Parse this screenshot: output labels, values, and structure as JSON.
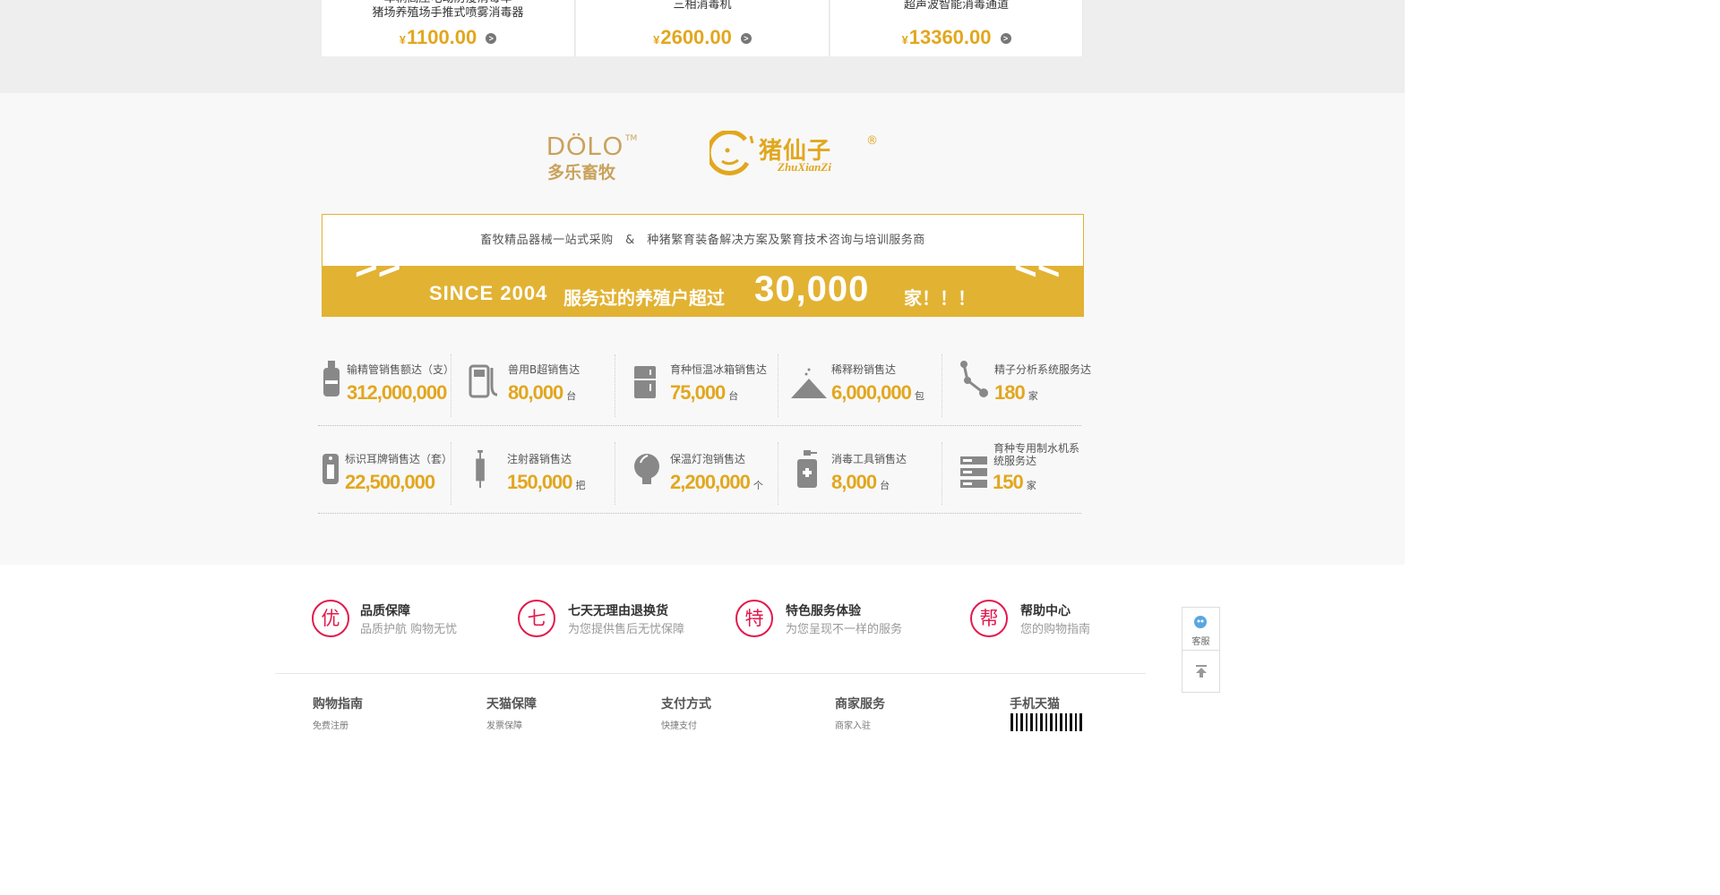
{
  "products": [
    {
      "name": "车辆高压电动防疫消毒车\n猪场养殖场手推式喷雾消毒器",
      "currency": "¥",
      "price": "1100.00",
      "arrow": ">"
    },
    {
      "name": "三相消毒机",
      "currency": "¥",
      "price": "2600.00",
      "arrow": ">"
    },
    {
      "name": "超声波智能消毒通道",
      "currency": "¥",
      "price": "13360.00",
      "arrow": ">"
    }
  ],
  "brands": {
    "dolo_name": "DÖLO",
    "dolo_tm": "TM",
    "dolo_cn": "多乐畜牧",
    "zhuxianzi_cn": "猪仙子",
    "zhuxianzi_reg": "®",
    "zhuxianzi_pinyin": "ZhuXianZi"
  },
  "promo": {
    "tagline": "畜牧精品器械一站式采购　&　种猪繁育装备解决方案及繁育技术咨询与培训服务商",
    "since": "SINCE 2004",
    "served": "服务过的养殖户超过",
    "count": "30,000",
    "suffix": "家！！！",
    "chev_left": ">>",
    "chev_right": "<<"
  },
  "stats": [
    {
      "label": "输精管销售额达（支）",
      "value": "312,000,000",
      "unit": "",
      "icon": "semen-bottle-icon"
    },
    {
      "label": "兽用B超销售达",
      "value": "80,000",
      "unit": "台",
      "icon": "ultrasound-icon"
    },
    {
      "label": "育种恒温冰箱销售达",
      "value": "75,000",
      "unit": "台",
      "icon": "fridge-icon"
    },
    {
      "label": "稀释粉销售达",
      "value": "6,000,000",
      "unit": "包",
      "icon": "powder-pile-icon"
    },
    {
      "label": "精子分析系统服务达",
      "value": "180",
      "unit": "家",
      "icon": "network-icon"
    },
    {
      "label": "标识耳牌销售达（套）",
      "value": "22,500,000",
      "unit": "",
      "icon": "ear-tag-icon"
    },
    {
      "label": "注射器销售达",
      "value": "150,000",
      "unit": "把",
      "icon": "syringe-icon"
    },
    {
      "label": "保温灯泡销售达",
      "value": "2,200,000",
      "unit": "个",
      "icon": "bulb-icon"
    },
    {
      "label": "消毒工具销售达",
      "value": "8,000",
      "unit": "台",
      "icon": "spray-bottle-icon"
    },
    {
      "label": "育种专用制水机系统服务达",
      "value": "150",
      "unit": "家",
      "icon": "server-icon"
    }
  ],
  "guarantees": [
    {
      "glyph": "优",
      "title": "品质保障",
      "subtitle": "品质护航 购物无忧"
    },
    {
      "glyph": "七",
      "title": "七天无理由退换货",
      "subtitle": "为您提供售后无忧保障"
    },
    {
      "glyph": "特",
      "title": "特色服务体验",
      "subtitle": "为您呈现不一样的服务"
    },
    {
      "glyph": "帮",
      "title": "帮助中心",
      "subtitle": "您的购物指南"
    }
  ],
  "footer": [
    {
      "title": "购物指南",
      "link": "免费注册"
    },
    {
      "title": "天猫保障",
      "link": "发票保障"
    },
    {
      "title": "支付方式",
      "link": "快捷支付"
    },
    {
      "title": "商家服务",
      "link": "商家入驻"
    },
    {
      "title": "手机天猫",
      "link": ""
    }
  ],
  "side": {
    "service_label": "客服"
  },
  "colors": {
    "gold": "#e2a71f",
    "banner": "#e2b233",
    "red": "#e2194c"
  }
}
